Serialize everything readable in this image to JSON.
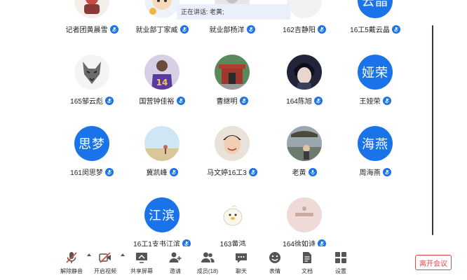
{
  "speaking_banner": "正在讲话: 老黄;",
  "participants": [
    {
      "name": "记者团黄晨雪",
      "avatar_type": "photo",
      "avatar_icon": "red-figure-avatar",
      "mic": "on"
    },
    {
      "name": "就业部丁家威",
      "avatar_type": "photo",
      "avatar_icon": "cartoon-avatar",
      "mic": "on"
    },
    {
      "name": "就业部杨洋",
      "avatar_type": "photo",
      "avatar_icon": "default-grey-avatar",
      "mic": "on"
    },
    {
      "name": "162吉静阳",
      "avatar_type": "photo",
      "avatar_icon": "blank-avatar",
      "mic": "on"
    },
    {
      "name": "16工5戴云晶",
      "avatar_type": "text",
      "avatar_text": "云晶",
      "mic": "on"
    },
    {
      "name": "165邹云彪",
      "avatar_type": "photo",
      "avatar_icon": "wolf-sketch-avatar",
      "mic": "on"
    },
    {
      "name": "国营钟佳裕",
      "avatar_type": "photo",
      "avatar_icon": "purple-jersey-avatar",
      "mic": "on"
    },
    {
      "name": "曹继明",
      "avatar_type": "photo",
      "avatar_icon": "temple-gate-avatar",
      "mic": "on"
    },
    {
      "name": "164陈旭",
      "avatar_type": "photo",
      "avatar_icon": "anime-boy-avatar",
      "mic": "on"
    },
    {
      "name": "王娅荣",
      "avatar_type": "text",
      "avatar_text": "娅荣",
      "mic": "on"
    },
    {
      "name": "161闵思梦",
      "avatar_type": "text",
      "avatar_text": "思梦",
      "mic": "on"
    },
    {
      "name": "冀凯峰",
      "avatar_type": "photo",
      "avatar_icon": "sky-field-avatar",
      "mic": "on"
    },
    {
      "name": "马文婷16工3",
      "avatar_type": "photo",
      "avatar_icon": "smiling-boy-avatar",
      "mic": "on"
    },
    {
      "name": "老黄",
      "avatar_type": "photo",
      "avatar_icon": "lake-tree-avatar",
      "mic": "speaking"
    },
    {
      "name": "周海燕",
      "avatar_type": "text",
      "avatar_text": "海燕",
      "mic": "on"
    },
    {
      "name": "16工1支书江滨",
      "avatar_type": "text",
      "avatar_text": "江滨",
      "mic": "on"
    },
    {
      "name": "163黄鸿",
      "avatar_type": "photo",
      "avatar_icon": "cartoon-duck-avatar",
      "mic": "none"
    },
    {
      "name": "164徐如诗",
      "avatar_type": "photo",
      "avatar_icon": "pink-card-avatar",
      "mic": "on"
    }
  ],
  "toolbar": {
    "unmute": "解除静音",
    "start_video": "开启视频",
    "share_screen": "共享屏幕",
    "invite": "邀请",
    "members": "成员(18)",
    "chat": "聊天",
    "reactions": "表情",
    "documents": "文档",
    "settings": "设置",
    "leave": "离开会议"
  },
  "colors": {
    "accent": "#1a73e8",
    "leave": "#e0484b",
    "muted_red": "#e0484b"
  }
}
